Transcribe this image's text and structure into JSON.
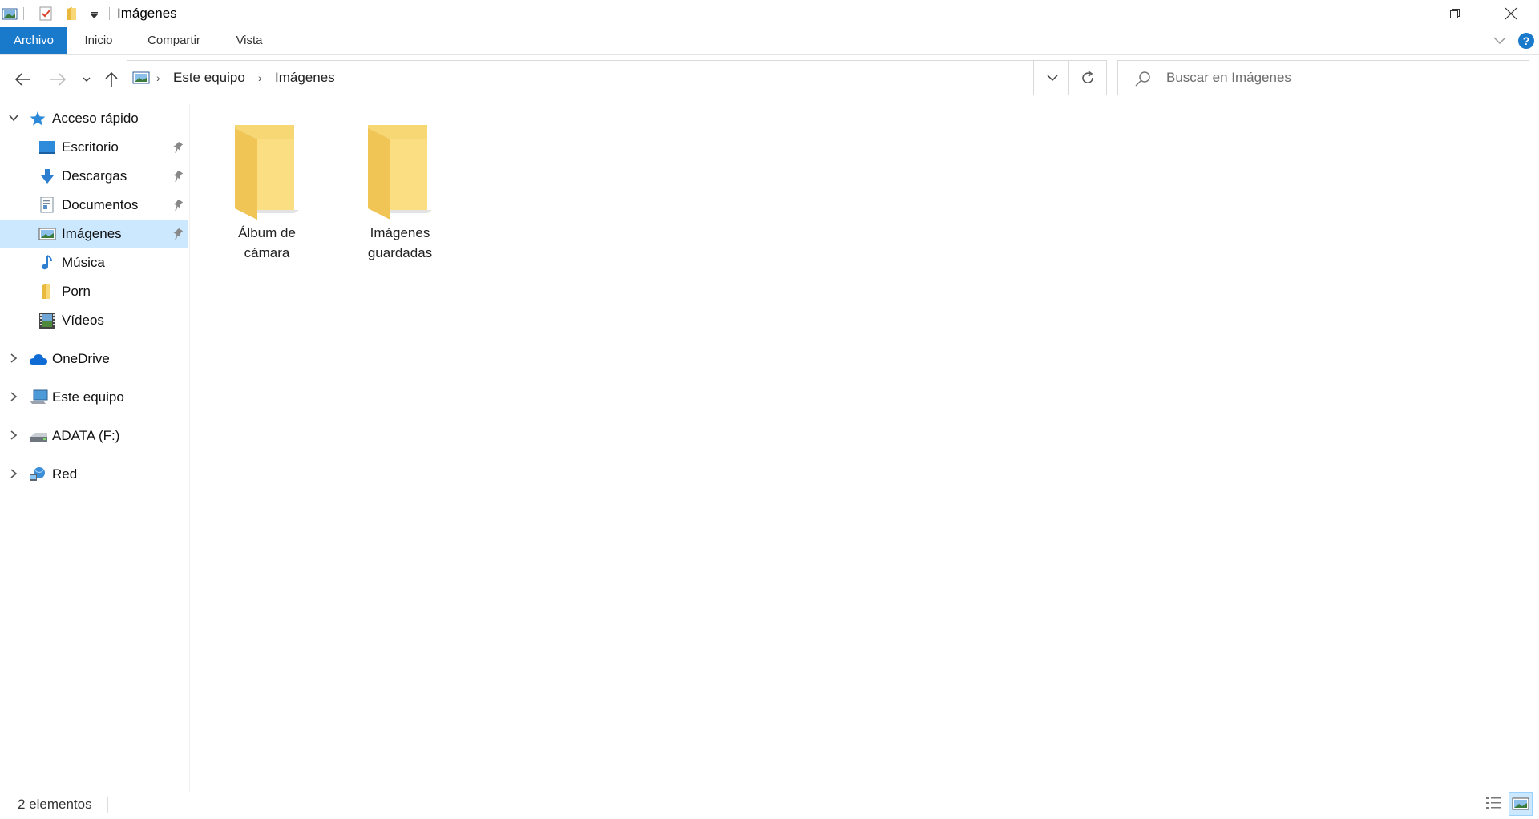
{
  "window": {
    "title": "Imágenes",
    "controls": [
      "minimize",
      "restore",
      "close"
    ]
  },
  "ribbon": {
    "tabs": [
      {
        "label": "Archivo",
        "active": true
      },
      {
        "label": "Inicio",
        "active": false
      },
      {
        "label": "Compartir",
        "active": false
      },
      {
        "label": "Vista",
        "active": false
      }
    ],
    "accent_color": "#1979ca"
  },
  "address": {
    "breadcrumbs": [
      "Este equipo",
      "Imágenes"
    ],
    "search_placeholder": "Buscar en Imágenes"
  },
  "sidebar": {
    "quick_access_label": "Acceso rápido",
    "quick_access_items": [
      {
        "label": "Escritorio",
        "icon": "desktop-icon",
        "pinned": true,
        "selected": false
      },
      {
        "label": "Descargas",
        "icon": "download-icon",
        "pinned": true,
        "selected": false
      },
      {
        "label": "Documentos",
        "icon": "document-icon",
        "pinned": true,
        "selected": false
      },
      {
        "label": "Imágenes",
        "icon": "pictures-icon",
        "pinned": true,
        "selected": true
      },
      {
        "label": "Música",
        "icon": "music-icon",
        "pinned": false,
        "selected": false
      },
      {
        "label": "Porn",
        "icon": "folder-icon",
        "pinned": false,
        "selected": false
      },
      {
        "label": "Vídeos",
        "icon": "video-icon",
        "pinned": false,
        "selected": false
      }
    ],
    "roots": [
      {
        "label": "OneDrive",
        "icon": "onedrive-icon"
      },
      {
        "label": "Este equipo",
        "icon": "computer-icon"
      },
      {
        "label": "ADATA (F:)",
        "icon": "drive-icon"
      },
      {
        "label": "Red",
        "icon": "network-icon"
      }
    ],
    "selected_color": "#cce8ff"
  },
  "content": {
    "folders": [
      {
        "line1": "Álbum de",
        "line2": "cámara"
      },
      {
        "line1": "Imágenes",
        "line2": "guardadas"
      }
    ]
  },
  "status": {
    "item_count": "2 elementos"
  }
}
